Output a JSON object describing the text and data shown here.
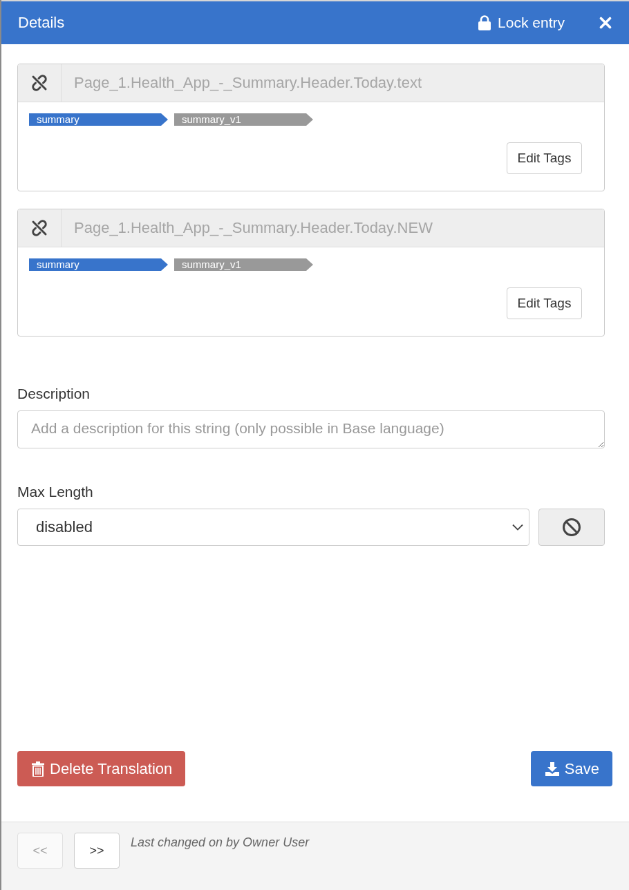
{
  "header": {
    "title": "Details",
    "lock_button": "Lock entry"
  },
  "keys": [
    {
      "field": {
        "placeholder": "Page_1.Health_App_-_Summary.Header.Today.text",
        "disabled": true
      },
      "tags": [
        {
          "label": "summary",
          "color": "#3874cb"
        },
        {
          "label": "summary_v1",
          "color": "#999999"
        }
      ],
      "edit_button": "Edit Tags"
    },
    {
      "field": {
        "placeholder": "Page_1.Health_App_-_Summary.Header.Today.NEW",
        "disabled": true
      },
      "tags": [
        {
          "label": "summary",
          "color": "#3874cb"
        },
        {
          "label": "summary_v1",
          "color": "#999999"
        }
      ],
      "edit_button": "Edit Tags"
    }
  ],
  "description": {
    "label": "Description",
    "placeholder": "Add a description for this string (only possible in Base language)"
  },
  "max_length": {
    "label": "Max Length",
    "value": "disabled"
  },
  "actions": [
    {
      "label": "Delete Translation",
      "kind": "delete"
    },
    {
      "label": "Save",
      "kind": "save"
    }
  ],
  "footer": {
    "nav": [
      {
        "label": "<<",
        "disabled": true
      },
      {
        "label": ">>",
        "disabled": false
      }
    ],
    "status": "Last changed on by Owner User"
  }
}
